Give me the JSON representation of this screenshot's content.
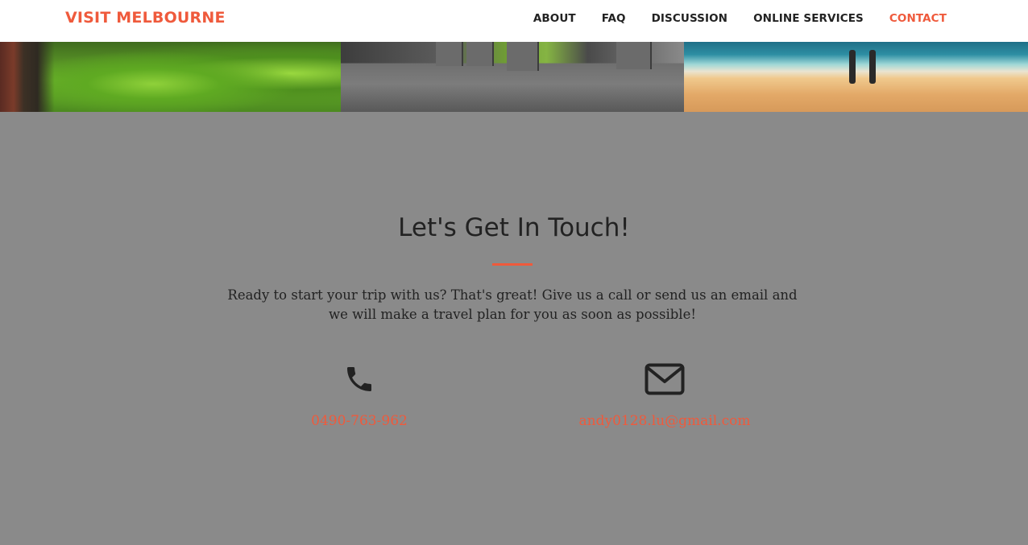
{
  "nav": {
    "brand": "VISIT MELBOURNE",
    "links": [
      "ABOUT",
      "FAQ",
      "DISCUSSION",
      "ONLINE SERVICES",
      "CONTACT"
    ],
    "active_link": "CONTACT"
  },
  "banner": {
    "images": [
      "forest-photo",
      "stone-ruins-photo",
      "beach-photo"
    ]
  },
  "contact": {
    "heading": "Let's Get In Touch!",
    "lead": "Ready to start your trip with us? That's great! Give us a call or send us an email and we will make a travel plan for you as soon as possible!",
    "phone": {
      "icon": "phone-icon",
      "value": "0490-763-962"
    },
    "email": {
      "icon": "envelope-icon",
      "value": "andy0128.lu@gmail.com"
    }
  },
  "colors": {
    "accent": "#ef5a3c",
    "background": "#8a8a8a",
    "navbar": "#ffffff",
    "text": "#222222"
  }
}
